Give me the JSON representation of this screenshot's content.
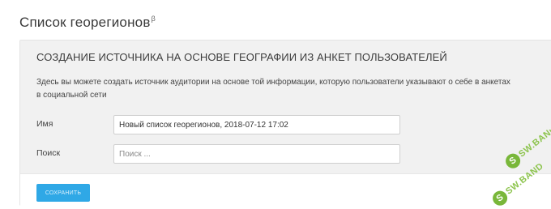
{
  "page": {
    "title": "Список георегионов",
    "title_badge": "β"
  },
  "panel": {
    "header": "СОЗДАНИЕ ИСТОЧНИКА НА ОСНОВЕ ГЕОГРАФИИ ИЗ АНКЕТ ПОЛЬЗОВАТЕЛЕЙ",
    "description": "Здесь вы можете создать источник аудитории на основе той информации, которую пользователи указывают о себе в анкетах в социальной сети"
  },
  "form": {
    "name": {
      "label": "Имя",
      "value": "Новый список георегионов, 2018-07-12 17:02"
    },
    "search": {
      "label": "Поиск",
      "placeholder": "Поиск ..."
    }
  },
  "footer": {
    "save_label": "СОХРАНИТЬ"
  },
  "watermark": {
    "text": "SW.BAND",
    "letter": "S",
    "color": "#79b73a"
  }
}
